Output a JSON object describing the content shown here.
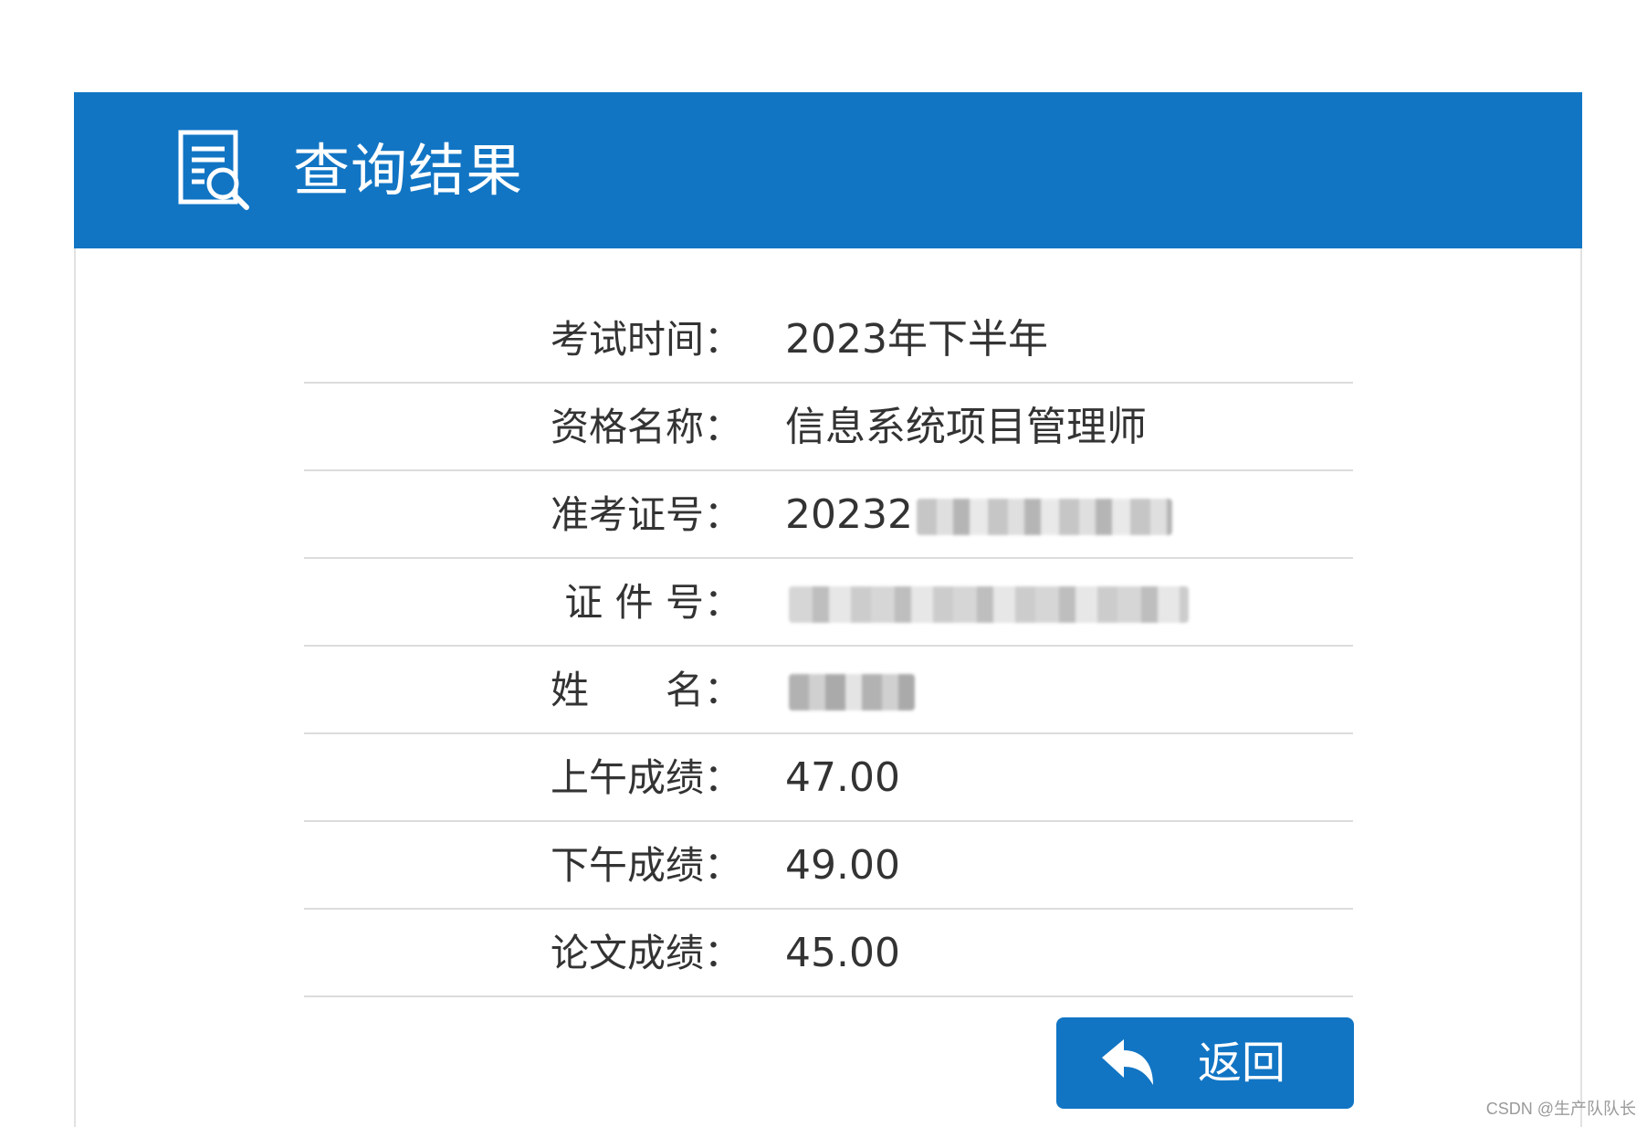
{
  "header": {
    "title": "查询结果",
    "icon": "search-document-icon",
    "color": "#1175c4"
  },
  "rows": [
    {
      "label": "考试时间：",
      "value": "2023年下半年",
      "redacted": false
    },
    {
      "label": "资格名称：",
      "value": "信息系统项目管理师",
      "redacted": false
    },
    {
      "label": "准考证号：",
      "value": "20232",
      "redacted": true
    },
    {
      "label": "证 件 号：",
      "value": "",
      "redacted": true
    },
    {
      "label": "姓　　名：",
      "value": "",
      "redacted": true
    },
    {
      "label": "上午成绩：",
      "value": "47.00",
      "redacted": false
    },
    {
      "label": "下午成绩：",
      "value": "49.00",
      "redacted": false
    },
    {
      "label": "论文成绩：",
      "value": "45.00",
      "redacted": false
    }
  ],
  "back_button": {
    "label": "返回",
    "icon": "reply-arrow-icon"
  },
  "watermark": "CSDN @生产队队长"
}
